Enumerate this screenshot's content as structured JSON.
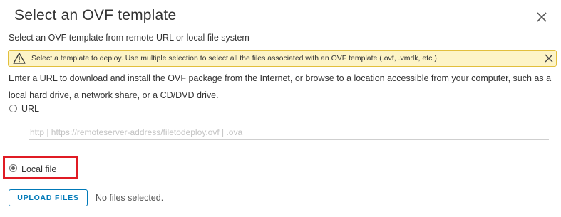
{
  "dialog": {
    "title": "Select an OVF template",
    "subtitle": "Select an OVF template from remote URL or local file system"
  },
  "alert": {
    "text": "Select a template to deploy. Use multiple selection to select all the files associated with an OVF template (.ovf, .vmdk, etc.)",
    "icon": "warning-icon",
    "color_bg": "#fdf4c7",
    "color_border": "#e2bf3c"
  },
  "description": "Enter a URL to download and install the OVF package from the Internet, or browse to a location accessible from your computer, such as a local hard drive, a network share, or a CD/DVD drive.",
  "source": {
    "url_option": {
      "label": "URL",
      "checked": false
    },
    "url_input": {
      "placeholder": "http | https://remoteserver-address/filetodeploy.ovf | .ova",
      "value": ""
    },
    "local_option": {
      "label": "Local file",
      "checked": true
    }
  },
  "upload": {
    "button_label": "UPLOAD FILES",
    "status": "No files selected."
  },
  "colors": {
    "accent": "#0079b8",
    "highlight": "#e01b24"
  }
}
